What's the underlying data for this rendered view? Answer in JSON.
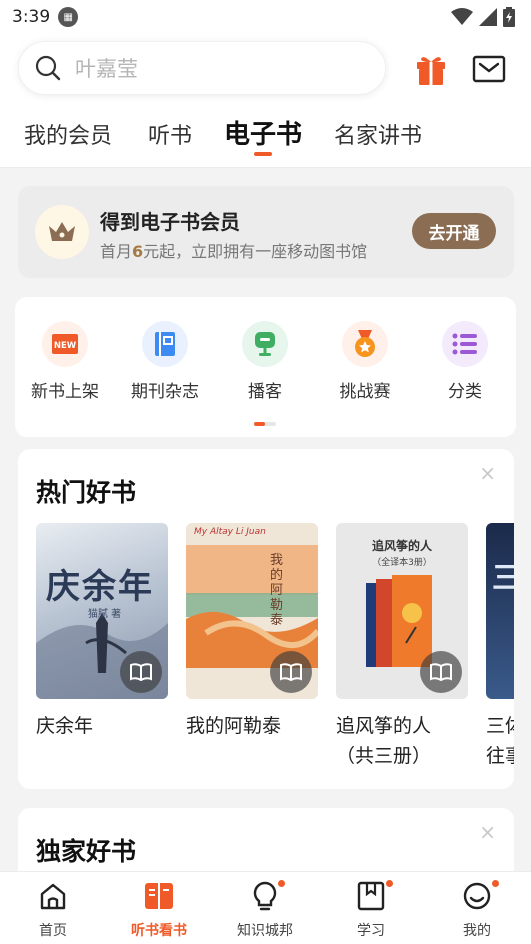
{
  "status": {
    "time": "3:39"
  },
  "search": {
    "placeholder": "叶嘉莹"
  },
  "tabs": [
    {
      "label": "我的会员"
    },
    {
      "label": "听书"
    },
    {
      "label": "电子书"
    },
    {
      "label": "名家讲书"
    }
  ],
  "member": {
    "title": "得到电子书会员",
    "subtitle_pre": "首月",
    "subtitle_price": "6",
    "subtitle_post": "元起，立即拥有一座移动图书馆",
    "button": "去开通"
  },
  "categories": [
    {
      "label": "新书上架",
      "icon": "new-icon",
      "badge": "NEW"
    },
    {
      "label": "期刊杂志",
      "icon": "magazine-icon"
    },
    {
      "label": "播客",
      "icon": "podcast-icon"
    },
    {
      "label": "挑战赛",
      "icon": "medal-icon"
    },
    {
      "label": "分类",
      "icon": "list-icon"
    }
  ],
  "hot_books": {
    "title": "热门好书",
    "close": "×",
    "items": [
      {
        "title": "庆余年",
        "cover_text": "庆余年",
        "cover_sub": "猫腻 著"
      },
      {
        "title": "我的阿勒泰",
        "cover_text": "我的阿勒泰",
        "cover_sub": "My Altay  Li Juan"
      },
      {
        "title": "追风筝的人\n（共三册）",
        "cover_text": "追风筝的人",
        "cover_sub": "（全译本3册）"
      },
      {
        "title": "三体\n往事",
        "cover_text": "三体"
      }
    ]
  },
  "exclusive": {
    "title": "独家好书",
    "close": "×"
  },
  "bottom_nav": [
    {
      "label": "首页",
      "icon": "home-icon"
    },
    {
      "label": "听书看书",
      "icon": "book-icon"
    },
    {
      "label": "知识城邦",
      "icon": "bulb-icon"
    },
    {
      "label": "学习",
      "icon": "study-icon"
    },
    {
      "label": "我的",
      "icon": "profile-icon"
    }
  ],
  "colors": {
    "accent": "#f05a28",
    "member_btn": "#8a6d52"
  }
}
